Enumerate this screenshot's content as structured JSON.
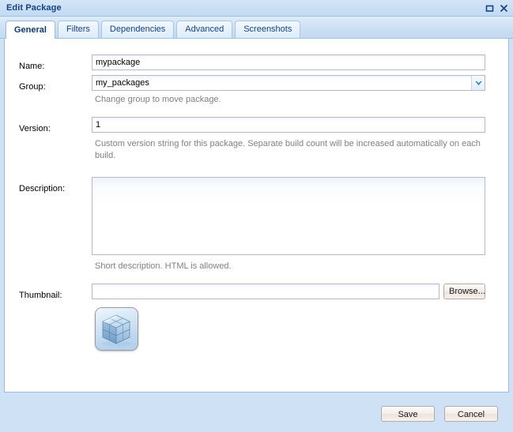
{
  "window": {
    "title": "Edit Package",
    "controls": [
      {
        "name": "maximize-icon",
        "label": "Maximize"
      },
      {
        "name": "close-icon",
        "label": "Close"
      }
    ]
  },
  "tabs": [
    {
      "label": "General",
      "active": true
    },
    {
      "label": "Filters",
      "active": false
    },
    {
      "label": "Dependencies",
      "active": false
    },
    {
      "label": "Advanced",
      "active": false
    },
    {
      "label": "Screenshots",
      "active": false
    }
  ],
  "form": {
    "name": {
      "label": "Name:",
      "value": "mypackage",
      "placeholder": ""
    },
    "group": {
      "label": "Group:",
      "value": "my_packages",
      "hint": "Change group to move package.",
      "options": [
        "my_packages"
      ]
    },
    "version": {
      "label": "Version:",
      "value": "1",
      "hint": "Custom version string for this package. Separate build count will be increased automatically on each build."
    },
    "description": {
      "label": "Description:",
      "value": "",
      "placeholder": "",
      "hint": "Short description. HTML is allowed."
    },
    "thumbnail": {
      "label": "Thumbnail:",
      "value": "",
      "placeholder": "",
      "browse_label": "Browse...",
      "preview_icon": "package-cube-icon"
    }
  },
  "footer": {
    "save_label": "Save",
    "cancel_label": "Cancel"
  },
  "colors": {
    "window_chrome": "#cfe2f5",
    "title_text": "#15428b",
    "panel_border": "#99bbe0",
    "hint_text": "#808080",
    "accent": "#15428b"
  }
}
